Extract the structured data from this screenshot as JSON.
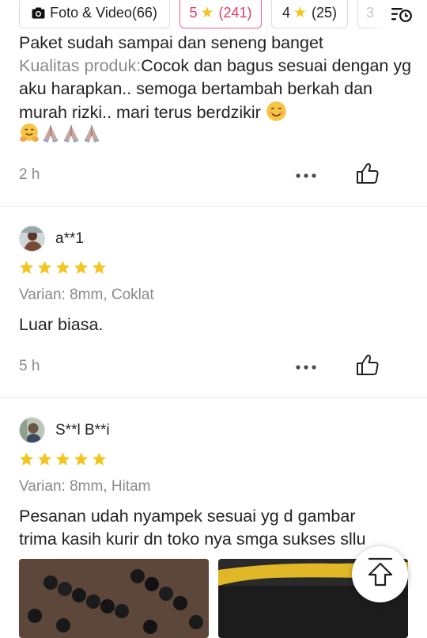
{
  "filters": {
    "media_label": "Foto & Video(66)",
    "five_star": {
      "rating": "5",
      "count": "(241)"
    },
    "four_star": {
      "rating": "4",
      "count": "(25)"
    },
    "three_star": {
      "rating": "3"
    },
    "media_icon": "camera-icon",
    "sort_icon": "sort-clock-icon"
  },
  "colors": {
    "accent": "#e23d66",
    "star": "#f3c521",
    "muted_text": "#8a8a8a"
  },
  "reviews": [
    {
      "partial_top_line": "Paket sudah sampai dan seneng banget",
      "quality_label": "Kualitas produk:",
      "body": "Cocok dan bagus sesuai dengan yg aku harapkan.. semoga bertambah berkah dan murah rizki.. mari terus berdzikir",
      "time": "2 h"
    },
    {
      "username": "a**1",
      "rating": 5,
      "variant": "Varian: 8mm, Coklat",
      "body": "Luar biasa.",
      "time": "5 h"
    },
    {
      "username": "S**l B**i",
      "rating": 5,
      "variant": "Varian: 8mm, Hitam",
      "body_line1": "Pesanan udah nyampek sesuai yg d gambar",
      "body_line2": "trima kasih kurir dn toko nya smga sukses sllu",
      "photo_count": 2
    }
  ],
  "icons": {
    "more": "more-dots-icon",
    "like": "thumbs-up-icon",
    "scroll_top": "arrow-up-to-top-icon"
  }
}
